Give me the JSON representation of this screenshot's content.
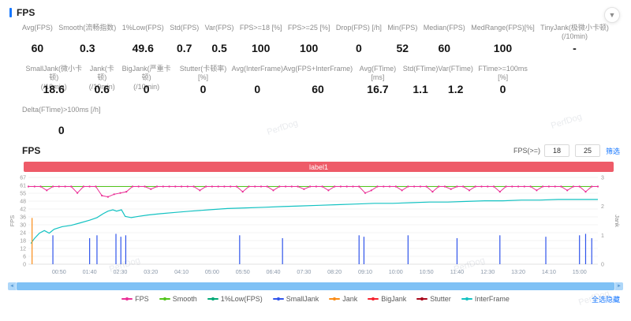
{
  "header": {
    "title": "FPS"
  },
  "watermark": "PerfDog",
  "stats": {
    "rows": [
      [
        {
          "label": "Avg(FPS)",
          "value": "60"
        },
        {
          "label": "Smooth(流畅指数)",
          "value": "0.3"
        },
        {
          "label": "1%Low(FPS)",
          "value": "49.6"
        },
        {
          "label": "Std(FPS)",
          "value": "0.7"
        },
        {
          "label": "Var(FPS)",
          "value": "0.5"
        },
        {
          "label": "FPS>=18 [%]",
          "value": "100"
        },
        {
          "label": "FPS>=25 [%]",
          "value": "100"
        },
        {
          "label": "Drop(FPS) [/h]",
          "value": "0"
        },
        {
          "label": "Min(FPS)",
          "value": "52"
        },
        {
          "label": "Median(FPS)",
          "value": "60"
        },
        {
          "label": "MedRange(FPS)[%]",
          "value": "100"
        },
        {
          "label": "TinyJank(极微小卡顿)",
          "label2": "(/10min)",
          "value": "-"
        }
      ],
      [
        {
          "label": "SmallJank(微小卡顿)",
          "label2": "(/10min)",
          "value": "18.6"
        },
        {
          "label": "Jank(卡顿)",
          "label2": "(/10min)",
          "value": "0.6"
        },
        {
          "label": "BigJank(严重卡顿)",
          "label2": "(/10min)",
          "value": "0"
        },
        {
          "label": "Stutter(卡顿率) [%]",
          "value": "0"
        },
        {
          "label": "Avg(InterFrame)",
          "value": "0"
        },
        {
          "label": "Avg(FPS+InterFrame)",
          "value": "60"
        },
        {
          "label": "Avg(FTime) [ms]",
          "value": "16.7"
        },
        {
          "label": "Std(FTime)",
          "value": "1.1"
        },
        {
          "label": "Var(FTime)",
          "value": "1.2"
        },
        {
          "label": "FTime>=100ms [%]",
          "value": "0"
        }
      ],
      [
        {
          "label": "Delta(FTime)>100ms [/h]",
          "value": "0"
        }
      ]
    ]
  },
  "chart_panel": {
    "title": "FPS",
    "filter": {
      "label": "FPS(>=)",
      "min": "18",
      "max": "25",
      "apply": "筛选"
    },
    "banner": "label1",
    "toggle_all": "全选隐藏"
  },
  "chart_data": {
    "type": "line",
    "title": "label1",
    "x_axis": {
      "range_s": [
        0,
        930
      ],
      "ticks": [
        {
          "t": 50,
          "label": "00:50"
        },
        {
          "t": 100,
          "label": "01:40"
        },
        {
          "t": 150,
          "label": "02:30"
        },
        {
          "t": 200,
          "label": "03:20"
        },
        {
          "t": 250,
          "label": "04:10"
        },
        {
          "t": 300,
          "label": "05:00"
        },
        {
          "t": 350,
          "label": "05:50"
        },
        {
          "t": 400,
          "label": "06:40"
        },
        {
          "t": 450,
          "label": "07:30"
        },
        {
          "t": 500,
          "label": "08:20"
        },
        {
          "t": 550,
          "label": "09:10"
        },
        {
          "t": 600,
          "label": "10:00"
        },
        {
          "t": 650,
          "label": "10:50"
        },
        {
          "t": 700,
          "label": "11:40"
        },
        {
          "t": 750,
          "label": "12:30"
        },
        {
          "t": 800,
          "label": "13:20"
        },
        {
          "t": 850,
          "label": "14:10"
        },
        {
          "t": 900,
          "label": "15:00"
        }
      ]
    },
    "y_axis_left": {
      "label": "FPS",
      "range": [
        0,
        67
      ],
      "ticks": [
        67,
        61,
        55,
        48,
        42,
        36,
        30,
        24,
        18,
        12,
        6,
        0
      ]
    },
    "y_axis_right": {
      "label": "Jank",
      "range": [
        0,
        3
      ],
      "ticks": [
        3,
        2,
        1,
        0
      ]
    },
    "grid": true,
    "legend_position": "bottom",
    "series": [
      {
        "name": "Smooth",
        "color": "#52c41a",
        "type": "line",
        "baseline": 60,
        "sample_step_s": 30,
        "markers": false
      },
      {
        "name": "InterFrame",
        "color": "#13c2c2",
        "type": "line",
        "points": [
          [
            4,
            16
          ],
          [
            10,
            20
          ],
          [
            18,
            24
          ],
          [
            26,
            26
          ],
          [
            34,
            24
          ],
          [
            42,
            27
          ],
          [
            55,
            29
          ],
          [
            70,
            30
          ],
          [
            85,
            32
          ],
          [
            100,
            34
          ],
          [
            112,
            36
          ],
          [
            122,
            39
          ],
          [
            130,
            41
          ],
          [
            138,
            42
          ],
          [
            144,
            41
          ],
          [
            152,
            42
          ],
          [
            158,
            37
          ],
          [
            168,
            36
          ],
          [
            180,
            37
          ],
          [
            195,
            38
          ],
          [
            215,
            39
          ],
          [
            240,
            40
          ],
          [
            265,
            41
          ],
          [
            295,
            42
          ],
          [
            325,
            43
          ],
          [
            355,
            43.5
          ],
          [
            385,
            44
          ],
          [
            415,
            44.5
          ],
          [
            445,
            45
          ],
          [
            475,
            45.5
          ],
          [
            505,
            46
          ],
          [
            535,
            46.5
          ],
          [
            565,
            47
          ],
          [
            595,
            47
          ],
          [
            625,
            47.5
          ],
          [
            655,
            48
          ],
          [
            685,
            48
          ],
          [
            715,
            48.5
          ],
          [
            745,
            49
          ],
          [
            775,
            49
          ],
          [
            805,
            49.5
          ],
          [
            835,
            49.5
          ],
          [
            865,
            50
          ],
          [
            895,
            50
          ],
          [
            930,
            50
          ]
        ]
      },
      {
        "name": "SmallJank",
        "color": "#2f54eb",
        "type": "spike",
        "axis": "right",
        "events": [
          [
            40,
            1
          ],
          [
            100,
            0.9
          ],
          [
            112,
            1
          ],
          [
            143,
            1.05
          ],
          [
            151,
            0.95
          ],
          [
            159,
            1
          ],
          [
            345,
            1
          ],
          [
            415,
            0.9
          ],
          [
            540,
            1
          ],
          [
            548,
            0.95
          ],
          [
            620,
            1
          ],
          [
            700,
            0.9
          ],
          [
            770,
            1
          ],
          [
            845,
            0.95
          ],
          [
            900,
            1
          ],
          [
            910,
            1.05
          ],
          [
            920,
            0.9
          ]
        ]
      },
      {
        "name": "Jank",
        "color": "#fa8c16",
        "type": "spike",
        "axis": "right",
        "events": [
          [
            6,
            1.6
          ]
        ]
      },
      {
        "name": "FPS",
        "color": "#eb2f96",
        "type": "line",
        "baseline": 60,
        "sample_step_s": 10,
        "markers": true,
        "dips": [
          [
            25,
            57
          ],
          [
            80,
            55
          ],
          [
            115,
            53
          ],
          [
            125,
            52
          ],
          [
            135,
            54
          ],
          [
            145,
            55
          ],
          [
            160,
            56
          ],
          [
            200,
            58
          ],
          [
            275,
            57
          ],
          [
            345,
            56
          ],
          [
            400,
            57
          ],
          [
            450,
            58
          ],
          [
            485,
            57
          ],
          [
            545,
            55
          ],
          [
            560,
            57
          ],
          [
            610,
            57
          ],
          [
            655,
            56
          ],
          [
            690,
            58
          ],
          [
            720,
            57
          ],
          [
            770,
            56
          ],
          [
            830,
            57
          ],
          [
            880,
            57
          ],
          [
            910,
            56
          ]
        ]
      }
    ],
    "legend": [
      {
        "label": "FPS",
        "color": "#eb2f96"
      },
      {
        "label": "Smooth",
        "color": "#52c41a"
      },
      {
        "label": "1%Low(FPS)",
        "color": "#00a876"
      },
      {
        "label": "SmallJank",
        "color": "#2f54eb"
      },
      {
        "label": "Jank",
        "color": "#fa8c16"
      },
      {
        "label": "BigJank",
        "color": "#f5222d"
      },
      {
        "label": "Stutter",
        "color": "#a8071a"
      },
      {
        "label": "InterFrame",
        "color": "#13c2c2"
      }
    ]
  }
}
